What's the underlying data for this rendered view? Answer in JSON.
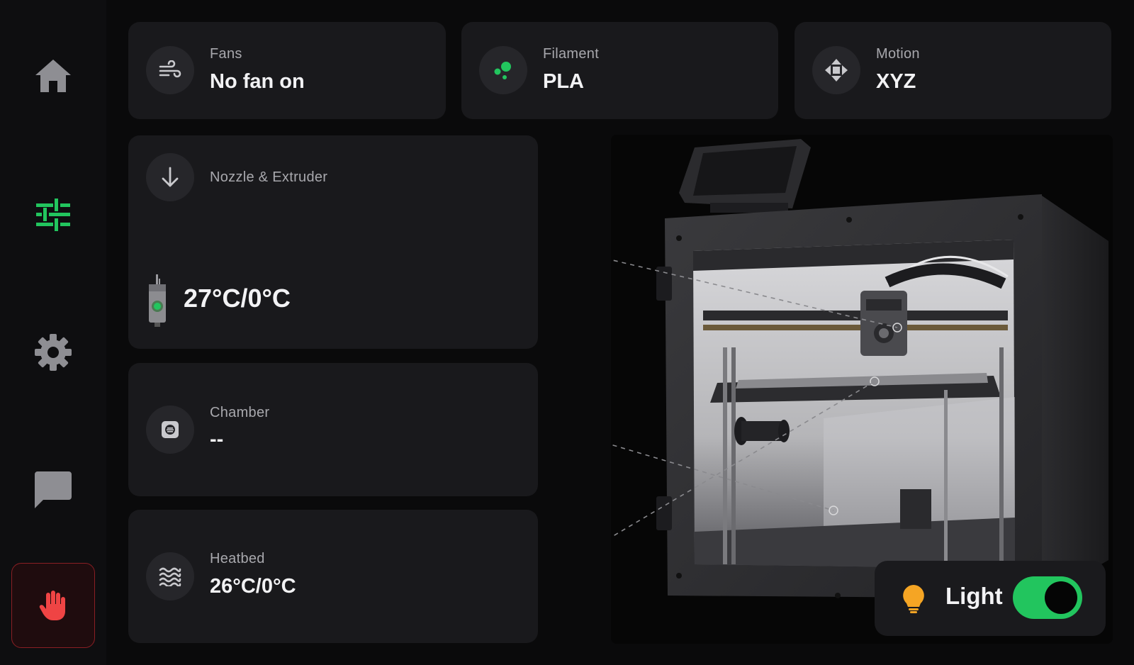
{
  "sidebar": {
    "items": [
      {
        "name": "home",
        "icon": "home-icon",
        "active": false
      },
      {
        "name": "tune",
        "icon": "sliders-icon",
        "active": true
      },
      {
        "name": "settings",
        "icon": "gear-icon",
        "active": false
      },
      {
        "name": "messages",
        "icon": "chat-icon",
        "active": false
      }
    ],
    "estop": {
      "icon": "hand-stop-icon"
    }
  },
  "status": {
    "fans": {
      "label": "Fans",
      "value": "No fan on",
      "icon": "fan-wind-icon"
    },
    "filament": {
      "label": "Filament",
      "value": "PLA",
      "icon": "filament-dots-icon"
    },
    "motion": {
      "label": "Motion",
      "value": "XYZ",
      "icon": "move-arrows-icon"
    }
  },
  "nozzle": {
    "label": "Nozzle & Extruder",
    "value": "27°C/0°C",
    "icon": "arrow-down-icon"
  },
  "chamber": {
    "label": "Chamber",
    "value": "--",
    "icon": "chamber-icon"
  },
  "heatbed": {
    "label": "Heatbed",
    "value": "26°C/0°C",
    "icon": "heat-waves-icon"
  },
  "light": {
    "label": "Light",
    "on": true,
    "icon": "lightbulb-icon"
  },
  "colors": {
    "accent": "#22c55e",
    "danger": "#ef4444",
    "bulb": "#f5a524",
    "card": "#19191c"
  }
}
